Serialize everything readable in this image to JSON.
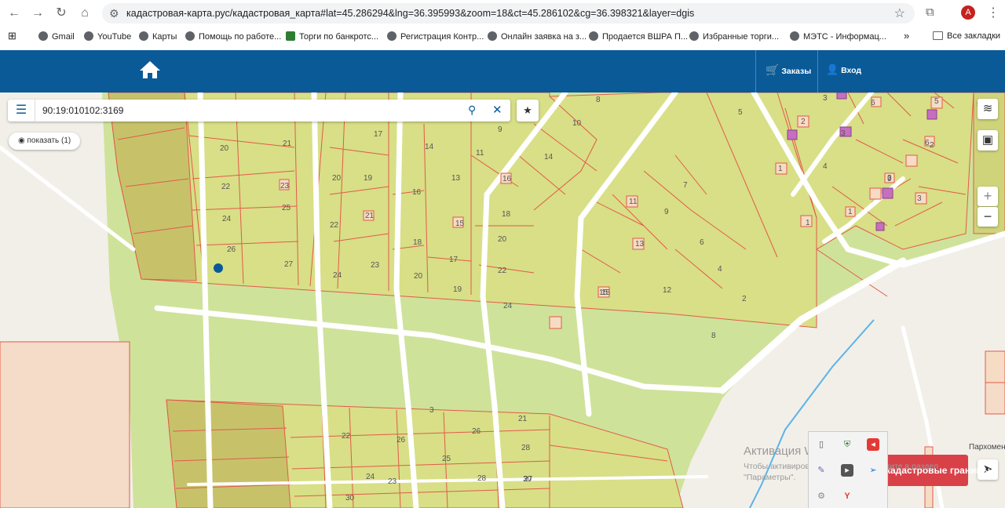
{
  "browser": {
    "url": "кадастровая-карта.рус/кадастровая_карта#lat=45.286294&lng=36.395993&zoom=18&ct=45.286102&cg=36.398321&layer=dgis",
    "profile_initial": "A",
    "bookmarks": [
      {
        "label": "Gmail"
      },
      {
        "label": "YouTube"
      },
      {
        "label": "Карты"
      },
      {
        "label": "Помощь по работе..."
      },
      {
        "label": "Торги по банкротс..."
      },
      {
        "label": "Регистрация Контр..."
      },
      {
        "label": "Онлайн заявка на з..."
      },
      {
        "label": "Продается ВШРА П..."
      },
      {
        "label": "Избранные торги..."
      },
      {
        "label": "МЭТС - Информац..."
      }
    ],
    "more_bookmarks": "»",
    "all_bookmarks": "Все закладки"
  },
  "header": {
    "orders_label": "Заказы",
    "login_label": "Вход",
    "color": "#0a5a98"
  },
  "search": {
    "value": "90:19:010102:3169",
    "show_label": "показать (1)"
  },
  "map": {
    "parcel_labels": [
      "20",
      "21",
      "22",
      "23",
      "24",
      "25",
      "26",
      "27",
      "20",
      "19",
      "17",
      "22",
      "21",
      "24",
      "23",
      "14",
      "16",
      "13",
      "18",
      "17",
      "20",
      "19",
      "11",
      "15",
      "16",
      "18",
      "20",
      "22",
      "24",
      "9",
      "10",
      "14",
      "8",
      "7",
      "11",
      "9",
      "13",
      "15",
      "12",
      "6",
      "4",
      "2",
      "8",
      "5",
      "3",
      "1",
      "2",
      "4",
      "3",
      "5",
      "6",
      "3",
      "1",
      "1",
      "3",
      "2",
      "6",
      "9",
      "5",
      "3",
      "22",
      "26",
      "21",
      "26",
      "25",
      "24",
      "28",
      "23",
      "27",
      "30",
      "28",
      "30",
      "15"
    ],
    "street_label": "Пархомен",
    "zoom_in": "+",
    "zoom_out": "−"
  },
  "watermark": {
    "line1": "Активация Windows",
    "line2": "Чтобы активировать Windows, перейдите в раздел",
    "line3": "\"Параметры\"."
  },
  "boundaries_button": "кадастровые границы"
}
